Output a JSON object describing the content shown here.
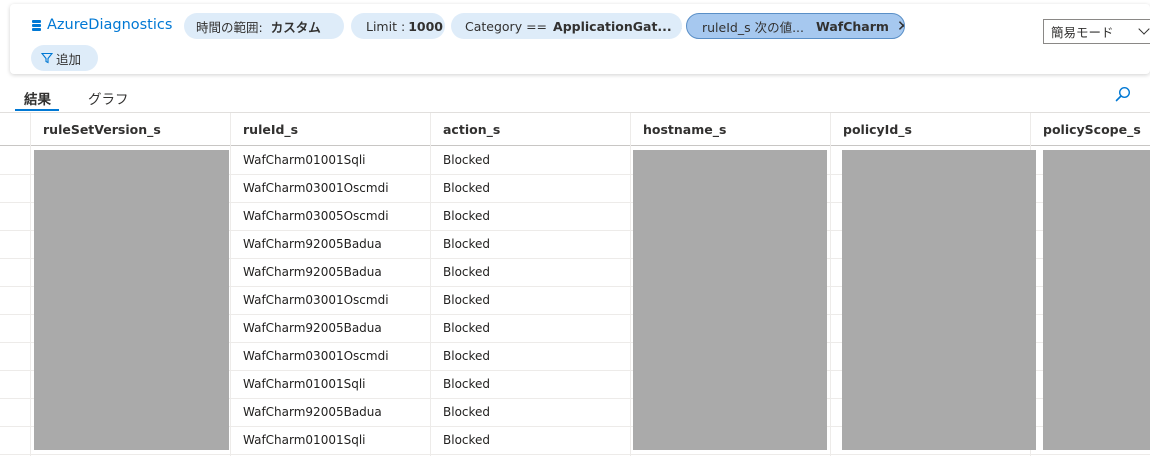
{
  "filters": {
    "table_name": "AzureDiagnostics",
    "db_icon": "database-icon",
    "time_range_label": "時間の範囲:",
    "time_range_value": "カスタム",
    "limit_label": "Limit :",
    "limit_value": "1000",
    "category_label": "Category ==",
    "category_value": "ApplicationGat...",
    "ruleid_label": "ruleId_s 次の値...",
    "ruleid_value": "WafCharm",
    "add_label": "追加",
    "mode_value": "簡易モード"
  },
  "tabs": [
    "結果",
    "グラフ"
  ],
  "columns": [
    "ruleSetVersion_s",
    "ruleId_s",
    "action_s",
    "hostname_s",
    "policyId_s",
    "policyScope_s"
  ],
  "rows": [
    {
      "ruleId": "WafCharm01001Sqli",
      "action": "Blocked"
    },
    {
      "ruleId": "WafCharm03001Oscmdi",
      "action": "Blocked"
    },
    {
      "ruleId": "WafCharm03005Oscmdi",
      "action": "Blocked"
    },
    {
      "ruleId": "WafCharm92005Badua",
      "action": "Blocked"
    },
    {
      "ruleId": "WafCharm92005Badua",
      "action": "Blocked"
    },
    {
      "ruleId": "WafCharm03001Oscmdi",
      "action": "Blocked"
    },
    {
      "ruleId": "WafCharm92005Badua",
      "action": "Blocked"
    },
    {
      "ruleId": "WafCharm03001Oscmdi",
      "action": "Blocked"
    },
    {
      "ruleId": "WafCharm01001Sqli",
      "action": "Blocked"
    },
    {
      "ruleId": "WafCharm92005Badua",
      "action": "Blocked"
    },
    {
      "ruleId": "WafCharm01001Sqli",
      "action": "Blocked"
    }
  ],
  "colors": {
    "accent": "#0078d4",
    "pill": "#deecf9",
    "pill_active": "#a6c8ef",
    "redaction": "#aaaaaa"
  }
}
